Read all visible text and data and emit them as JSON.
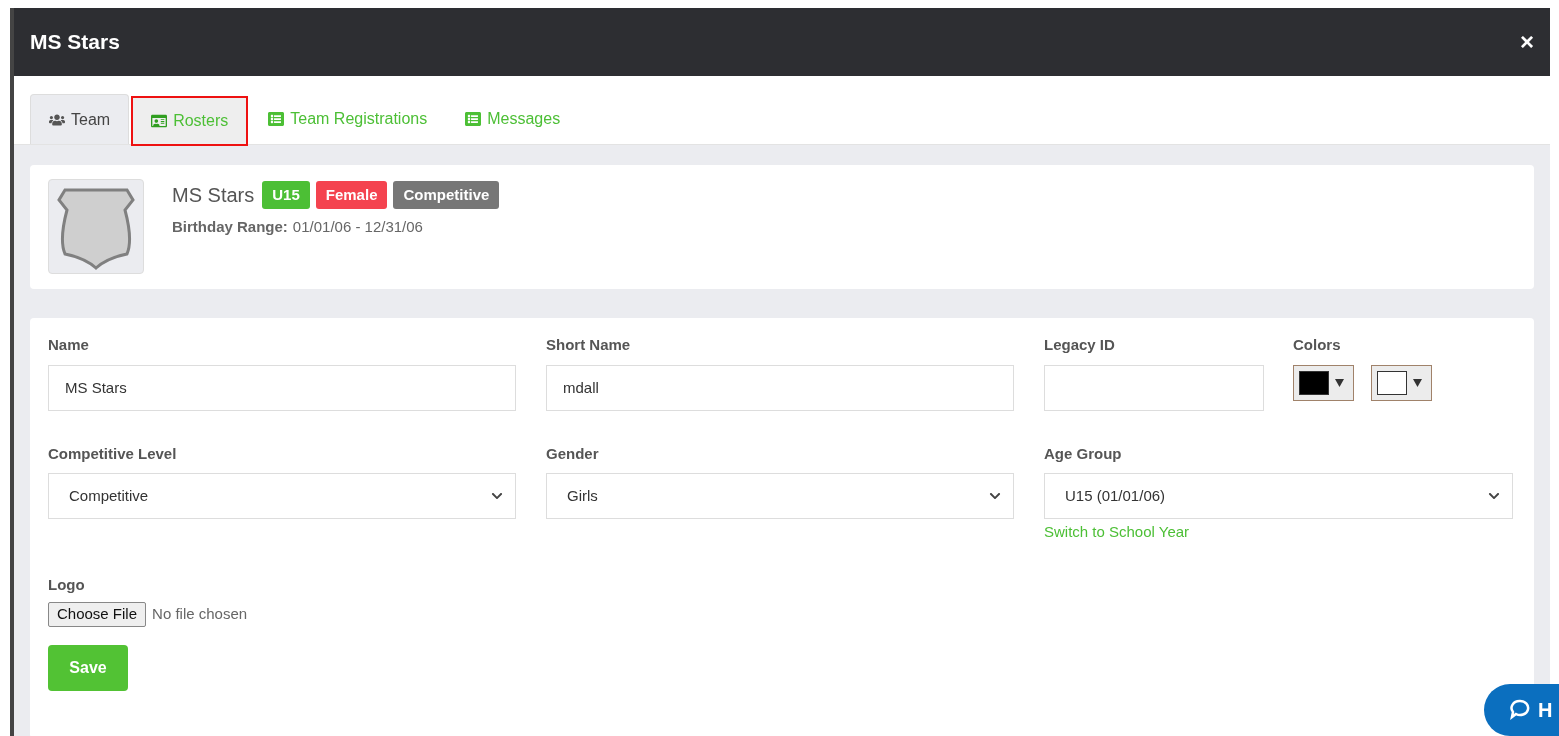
{
  "window": {
    "title": "MS Stars",
    "close": "×"
  },
  "tabs": [
    {
      "label": "Team",
      "kind": "users",
      "selected": true,
      "highlighted": false
    },
    {
      "label": "Rosters",
      "kind": "card",
      "selected": false,
      "highlighted": true
    },
    {
      "label": "Team Registrations",
      "kind": "list",
      "selected": false,
      "highlighted": false
    },
    {
      "label": "Messages",
      "kind": "list",
      "selected": false,
      "highlighted": false
    }
  ],
  "team": {
    "name": "MS Stars",
    "badges": [
      {
        "label": "U15",
        "color": "#4cbf35"
      },
      {
        "label": "Female",
        "color": "#f4434f"
      },
      {
        "label": "Competitive",
        "color": "#777777"
      }
    ],
    "birthday_label": "Birthday Range:",
    "birthday_value": "01/01/06 - 12/31/06"
  },
  "form": {
    "name": {
      "label": "Name",
      "value": "MS Stars"
    },
    "short_name": {
      "label": "Short Name",
      "value": "mdall"
    },
    "legacy_id": {
      "label": "Legacy ID"
    },
    "colors": {
      "label": "Colors",
      "swatches": [
        {
          "color": "#000000"
        },
        {
          "color": "#ffffff"
        }
      ]
    },
    "competitive_level": {
      "label": "Competitive Level",
      "value": "Competitive"
    },
    "gender": {
      "label": "Gender",
      "value": "Girls"
    },
    "age_group": {
      "label": "Age Group",
      "value": "U15 (01/01/06)",
      "link": "Switch to School Year"
    },
    "logo": {
      "label": "Logo",
      "button": "Choose File",
      "status": "No file chosen"
    },
    "save": "Save"
  },
  "help_button": {
    "label": "H"
  }
}
